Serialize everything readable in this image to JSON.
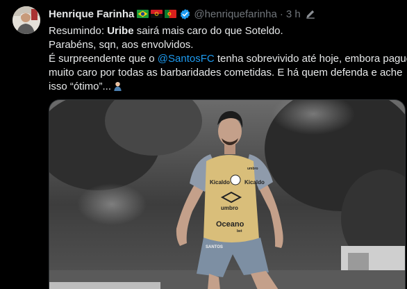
{
  "author": {
    "name": "Henrique Farinha",
    "handle": "@henriquefarinha",
    "separator": "·",
    "time": "3 h",
    "flags": [
      "brazil-flag-icon",
      "angola-flag-icon",
      "portugal-flag-icon"
    ],
    "verified_icon": "verified-badge-icon"
  },
  "tweet": {
    "line1_prefix": "Resumindo: ",
    "line1_bold": "Uribe",
    "line1_suffix": " sairá mais caro do que Soteldo.",
    "line2": "Parabéns, sqn, aos envolvidos.",
    "line3_prefix": "É surpreendente que o ",
    "line3_mention": "@SantosFC",
    "line3_suffix": " tenha sobrevivido até hoje, embora pague",
    "line4": "muito caro por todas as barbaridades cometidas. E há quem defenda e ache",
    "line5": "isso “ótimo”...",
    "emoji": "person-facepalming-emoji"
  },
  "media": {
    "shirt_logos": {
      "sponsor_chest_left": "Kicaldo",
      "sponsor_chest_right": "Kicaldo",
      "maker": "umbro",
      "main_sponsor": "Oceano",
      "main_sponsor_sub": "bet",
      "shoulder": "umbro",
      "number_badge": "SANTOS"
    }
  },
  "colors": {
    "background": "#000000",
    "text": "#e7e9ea",
    "secondary": "#71767b",
    "link": "#1d9bf0",
    "verified": "#1d9bf0"
  }
}
